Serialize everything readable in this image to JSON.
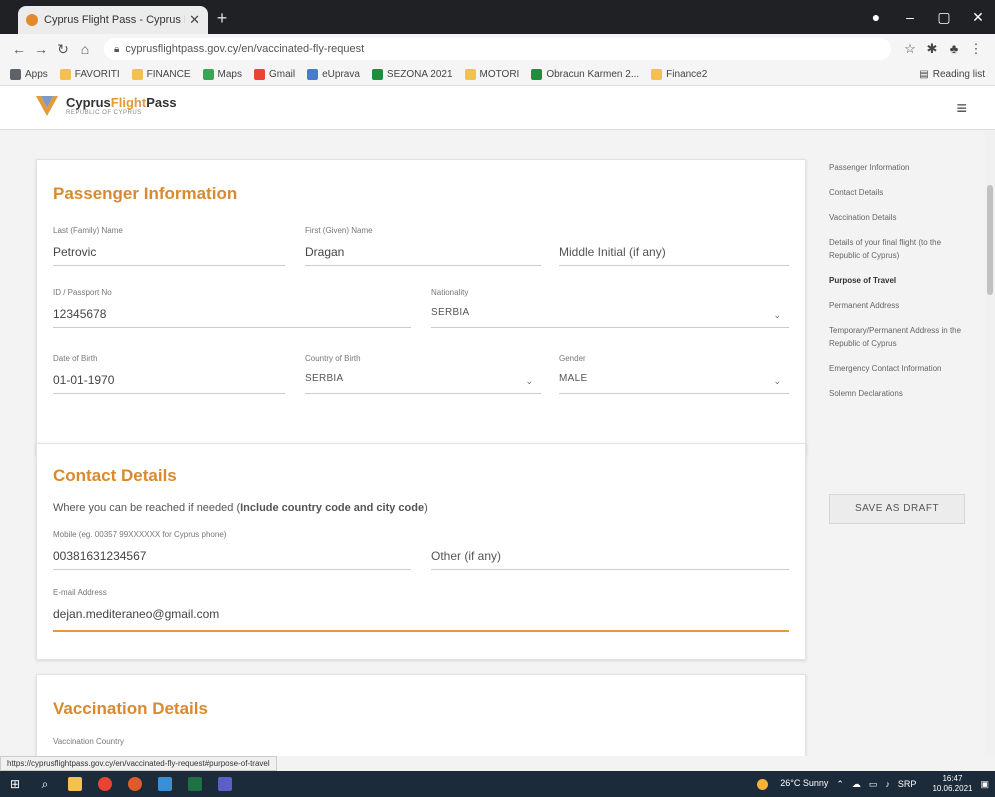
{
  "browser": {
    "tab_title": "Cyprus Flight Pass - Cyprus Fligh",
    "url": "cyprusflightpass.gov.cy/en/vaccinated-fly-request",
    "status_url": "https://cyprusflightpass.gov.cy/en/vaccinated-fly-request#purpose-of-travel"
  },
  "bookmarks": {
    "items": [
      {
        "label": "Apps",
        "color": "#5f6368"
      },
      {
        "label": "FAVORITI",
        "color": "#f2c14e"
      },
      {
        "label": "FINANCE",
        "color": "#f2c14e"
      },
      {
        "label": "Maps",
        "color": "#34a853"
      },
      {
        "label": "Gmail",
        "color": "#ea4335"
      },
      {
        "label": "eUprava",
        "color": "#4a7bd0"
      },
      {
        "label": "SEZONA 2021",
        "color": "#1e8e3e"
      },
      {
        "label": "MOTORI",
        "color": "#f2c14e"
      },
      {
        "label": "Obracun Karmen 2...",
        "color": "#1e8e3e"
      },
      {
        "label": "Finance2",
        "color": "#f2c14e"
      }
    ],
    "reading_list": "Reading list"
  },
  "site": {
    "brand_1": "Cyprus",
    "brand_2": "Flight",
    "brand_3": "Pass",
    "brand_sub": "REPUBLIC OF CYPRUS"
  },
  "passenger": {
    "title": "Passenger Information",
    "last_name_label": "Last (Family) Name",
    "last_name": "Petrovic",
    "first_name_label": "First (Given) Name",
    "first_name": "Dragan",
    "middle_placeholder": "Middle Initial (if any)",
    "passport_label": "ID / Passport No",
    "passport": "12345678",
    "nationality_label": "Nationality",
    "nationality": "SERBIA",
    "dob_label": "Date of Birth",
    "dob": "01-01-1970",
    "country_birth_label": "Country of Birth",
    "country_birth": "SERBIA",
    "gender_label": "Gender",
    "gender": "MALE"
  },
  "contact": {
    "title": "Contact Details",
    "note_prefix": "Where you can be reached if needed (",
    "note_bold": "Include country code and city code",
    "note_suffix": ")",
    "mobile_label": "Mobile (eg. 00357 99XXXXXX for Cyprus phone)",
    "mobile": "00381631234567",
    "other_placeholder": "Other (if any)",
    "email_label": "E-mail Address",
    "email": "dejan.mediteraneo@gmail.com"
  },
  "vaccination": {
    "title": "Vaccination Details",
    "country_label": "Vaccination Country"
  },
  "sidenav": {
    "items": [
      "Passenger Information",
      "Contact Details",
      "Vaccination Details",
      "Details of your final flight (to the Republic of Cyprus)",
      "Purpose of Travel",
      "Permanent Address",
      "Temporary/Permanent Address in the Republic of Cyprus",
      "Emergency Contact Information",
      "Solemn Declarations"
    ],
    "save_draft": "SAVE AS DRAFT"
  },
  "taskbar": {
    "weather": "26°C Sunny",
    "lang": "SRP",
    "time": "16:47",
    "date": "10.06.2021"
  }
}
